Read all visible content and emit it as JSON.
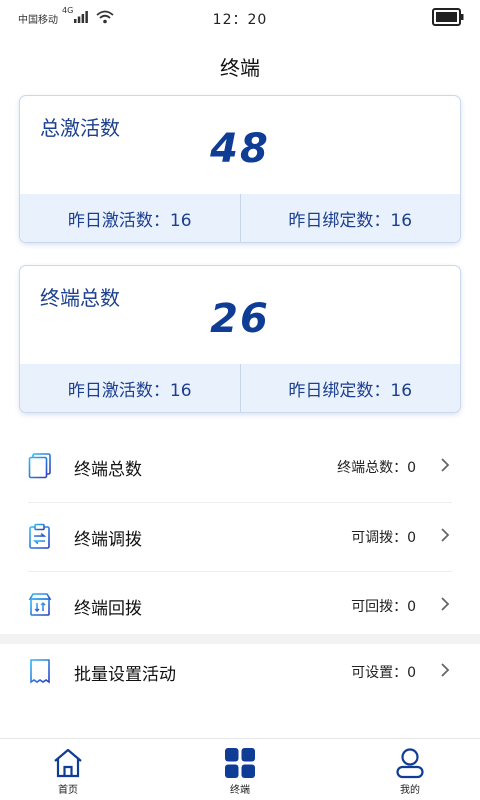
{
  "status_bar": {
    "carrier": "中国移动",
    "network": "4G",
    "time": "12：20"
  },
  "header": {
    "title": "终端"
  },
  "cards": [
    {
      "label": "总激活数",
      "value": "48",
      "left": "昨日激活数：16",
      "right": "昨日绑定数：16"
    },
    {
      "label": "终端总数",
      "value": "26",
      "left": "昨日激活数：16",
      "right": "昨日绑定数：16"
    }
  ],
  "list": [
    {
      "label": "终端总数",
      "value": "终端总数：0",
      "icon": "terminal-list-icon"
    },
    {
      "label": "终端调拨",
      "value": "可调拨：0",
      "icon": "transfer-clipboard-icon"
    },
    {
      "label": "终端回拨",
      "value": "可回拨：0",
      "icon": "return-box-icon"
    },
    {
      "label": "批量设置活动",
      "value": "可设置：0",
      "icon": "receipt-icon"
    }
  ],
  "bottom_nav": [
    {
      "label": "首页",
      "icon": "home-icon"
    },
    {
      "label": "终端",
      "icon": "grid-icon"
    },
    {
      "label": "我的",
      "icon": "user-icon"
    }
  ],
  "colors": {
    "primary": "#0f3d96",
    "card_footer_bg": "#e9f1fc",
    "icon_gradient_start": "#2fb8f0",
    "icon_gradient_end": "#2b3fc8"
  }
}
